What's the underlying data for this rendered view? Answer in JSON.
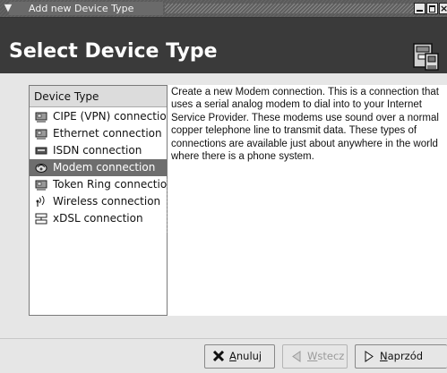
{
  "window": {
    "title": "Add new Device Type",
    "menu_glyph": "▼",
    "close_glyph": "×"
  },
  "header": {
    "title": "Select Device Type",
    "icon": "network-card-icon"
  },
  "device_list": {
    "column_header": "Device Type",
    "items": [
      {
        "label": "CIPE (VPN) connection",
        "icon": "network-card-icon",
        "selected": false
      },
      {
        "label": "Ethernet connection",
        "icon": "network-card-icon",
        "selected": false
      },
      {
        "label": "ISDN connection",
        "icon": "isdn-card-icon",
        "selected": false
      },
      {
        "label": "Modem connection",
        "icon": "modem-icon",
        "selected": true
      },
      {
        "label": "Token Ring connection",
        "icon": "network-card-icon",
        "selected": false
      },
      {
        "label": "Wireless connection",
        "icon": "wireless-icon",
        "selected": false
      },
      {
        "label": "xDSL connection",
        "icon": "xdsl-icon",
        "selected": false
      }
    ]
  },
  "description": "Create a new Modem connection.  This is a connection that uses a serial analog modem to dial into to your Internet Service Provider. These modems use sound over a normal copper telephone line to transmit data.  These types of connections are available just about anywhere in the world where there is a phone system.",
  "buttons": {
    "cancel": {
      "label": "Anuluj",
      "mnemonic": "A",
      "rest": "nuluj",
      "icon": "cancel-x-icon",
      "enabled": true
    },
    "back": {
      "label": "Wstecz",
      "mnemonic": "W",
      "rest": "stecz",
      "icon": "back-arrow-icon",
      "enabled": false
    },
    "next": {
      "label": "Naprzód",
      "mnemonic": "N",
      "rest": "aprzód",
      "icon": "forward-arrow-icon",
      "enabled": true
    }
  },
  "colors": {
    "header_bg": "#3a3a3a",
    "selection_bg": "#6e6e6e",
    "window_bg": "#e6e6e6"
  }
}
